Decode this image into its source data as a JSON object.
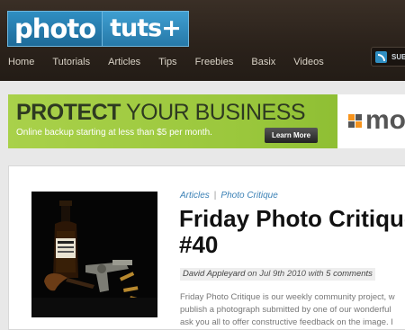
{
  "site": {
    "logo_photo": "photo",
    "logo_tuts": "tuts+",
    "nav": [
      "Home",
      "Tutorials",
      "Articles",
      "Tips",
      "Freebies",
      "Basix",
      "Videos"
    ],
    "subscribe_label": "SUB"
  },
  "banner": {
    "headline_bold": "PROTECT",
    "headline_light": " YOUR BUSINESS",
    "subline": "Online backup starting at less than $5 per month.",
    "button_label": "Learn More",
    "brand_text": "mo"
  },
  "article": {
    "categories": [
      "Articles",
      "Photo Critique"
    ],
    "title_line1": "Friday Photo Critique",
    "title_line2": "#40",
    "author": "David Appleyard",
    "date_text": " on Jul 9th 2010 with ",
    "comments": "5 comments",
    "excerpt_lines": [
      "Friday Photo Critique is our weekly community project, w",
      "publish a photograph submitted by one of our wonderful",
      "ask you all to offer constructive feedback on the image. I"
    ]
  },
  "colors": {
    "accent_blue": "#2f8ec2",
    "banner_green": "#a9d14a",
    "header_brown": "#2b221b"
  }
}
